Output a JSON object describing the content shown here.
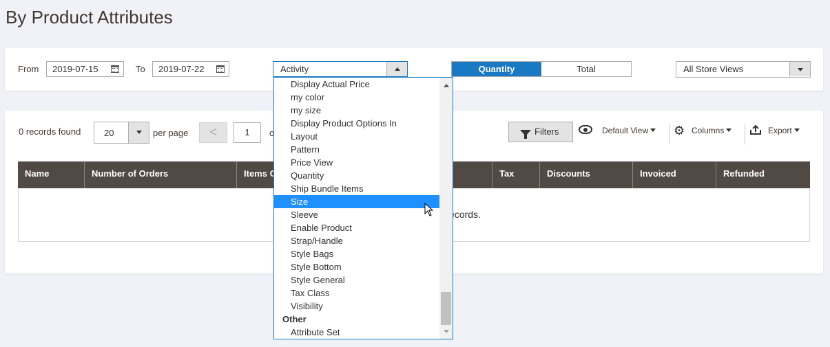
{
  "page": {
    "title": "By Product Attributes"
  },
  "filters": {
    "from_label": "From",
    "from_date": "2019-07-15",
    "to_label": "To",
    "to_date": "2019-07-22",
    "attribute_select": "Activity",
    "toggle": {
      "quantity": "Quantity",
      "total": "Total",
      "active": "Quantity"
    },
    "store_view": "All Store Views"
  },
  "grid_toolbar": {
    "records_found": "0 records found",
    "per_page_value": "20",
    "per_page_label": "per page",
    "prev_symbol": "<",
    "page_value": "1",
    "of_label": "o",
    "filters_label": "Filters",
    "default_view_label": "Default View",
    "columns_label": "Columns",
    "export_label": "Export"
  },
  "grid": {
    "columns": [
      "Name",
      "Number of Orders",
      "Items O",
      "",
      "Tax",
      "Discounts",
      "Invoiced",
      "Refunded"
    ],
    "empty_message": "ecords."
  },
  "dropdown": {
    "items": [
      "Display Actual Price",
      "my color",
      "my size",
      "Display Product Options In",
      "Layout",
      "Pattern",
      "Price View",
      "Quantity",
      "Ship Bundle Items",
      "Size",
      "Sleeve",
      "Enable Product",
      "Strap/Handle",
      "Style Bags",
      "Style Bottom",
      "Style General",
      "Tax Class",
      "Visibility"
    ],
    "selected": "Size",
    "group_label": "Other",
    "group_items": [
      "Attribute Set"
    ]
  },
  "colors": {
    "accent": "#1979c3",
    "grid_header": "#514943",
    "selected_option": "#1e90ff"
  }
}
